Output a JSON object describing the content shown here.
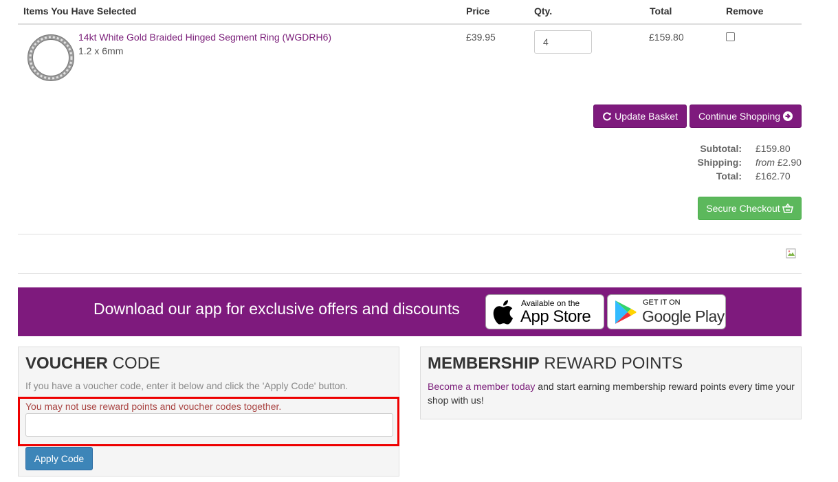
{
  "table": {
    "headers": {
      "item": "Items You Have Selected",
      "price": "Price",
      "qty": "Qty.",
      "total": "Total",
      "remove": "Remove"
    },
    "rows": [
      {
        "name": "14kt White Gold Braided Hinged Segment Ring (WGDRH6)",
        "size": "1.2 x 6mm",
        "price": "£39.95",
        "qty": "4",
        "total": "£159.80"
      }
    ]
  },
  "buttons": {
    "update": "Update Basket",
    "continue": "Continue Shopping",
    "checkout": "Secure Checkout",
    "apply": "Apply Code"
  },
  "summary": {
    "subtotal_label": "Subtotal:",
    "subtotal": "£159.80",
    "shipping_label": "Shipping:",
    "shipping_prefix": "from",
    "shipping": "£2.90",
    "total_label": "Total:",
    "total": "£162.70"
  },
  "banner": {
    "text": "Download our app for exclusive offers and discounts",
    "appstore_small": "Available on the",
    "appstore_big": "App Store",
    "play_small": "GET IT ON",
    "play_big": "Google Play"
  },
  "voucher": {
    "title_bold": "VOUCHER",
    "title_rest": "CODE",
    "description": "If you have a voucher code, enter it below and click the 'Apply Code' button.",
    "error": "You may not use reward points and voucher codes together.",
    "input_value": ""
  },
  "membership": {
    "title_bold": "MEMBERSHIP",
    "title_rest": "REWARD POINTS",
    "link_text": "Become a member today",
    "text": "and start earning membership reward points every time your shop with us!"
  },
  "colors": {
    "brand_purple": "#7e1a7d",
    "checkout_green": "#5cb85c",
    "apply_blue": "#3d85b8",
    "error_red": "#a94442",
    "highlight_red": "#ee0000"
  }
}
